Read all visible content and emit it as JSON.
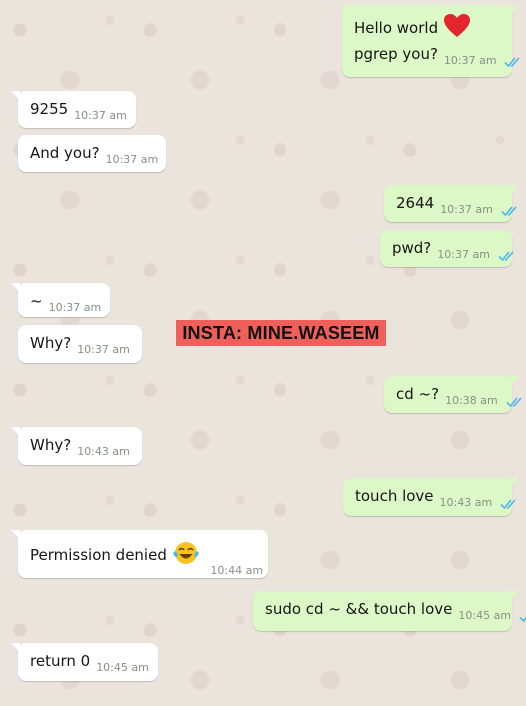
{
  "accent": {
    "outgoing_bubble": "#dcf8c6",
    "incoming_bubble": "#ffffff",
    "read_ticks": "#4fb6ec",
    "watermark_bg": "#f0605a"
  },
  "watermark": "INSTA: MINE.WASEEM",
  "messages": [
    {
      "side": "out",
      "line1": "Hello world",
      "line2": "pgrep you?",
      "time": "10:37 am",
      "status_icon": "double-check-read-icon",
      "emoji": "red-heart-icon"
    },
    {
      "side": "in",
      "text": "9255",
      "time": "10:37 am"
    },
    {
      "side": "in",
      "text": "And you?",
      "time": "10:37 am"
    },
    {
      "side": "out",
      "text": "2644",
      "time": "10:37 am",
      "status_icon": "double-check-read-icon"
    },
    {
      "side": "out",
      "text": "pwd?",
      "time": "10:37 am",
      "status_icon": "double-check-read-icon"
    },
    {
      "side": "in",
      "text": "~",
      "time": "10:37 am"
    },
    {
      "side": "in",
      "text": "Why?",
      "time": "10:37 am"
    },
    {
      "side": "out",
      "text": "cd ~?",
      "time": "10:38 am",
      "status_icon": "double-check-read-icon"
    },
    {
      "side": "in",
      "text": "Why?",
      "time": "10:43 am"
    },
    {
      "side": "out",
      "text": "touch love",
      "time": "10:43 am",
      "status_icon": "double-check-read-icon"
    },
    {
      "side": "in",
      "text": "Permission denied",
      "time": "10:44 am",
      "emoji": "tears-of-joy-emoji"
    },
    {
      "side": "out",
      "text": "sudo cd ~ && touch love",
      "time": "10:45 am",
      "status_icon": "double-check-read-icon"
    },
    {
      "side": "in",
      "text": "return 0",
      "time": "10:45 am"
    }
  ]
}
